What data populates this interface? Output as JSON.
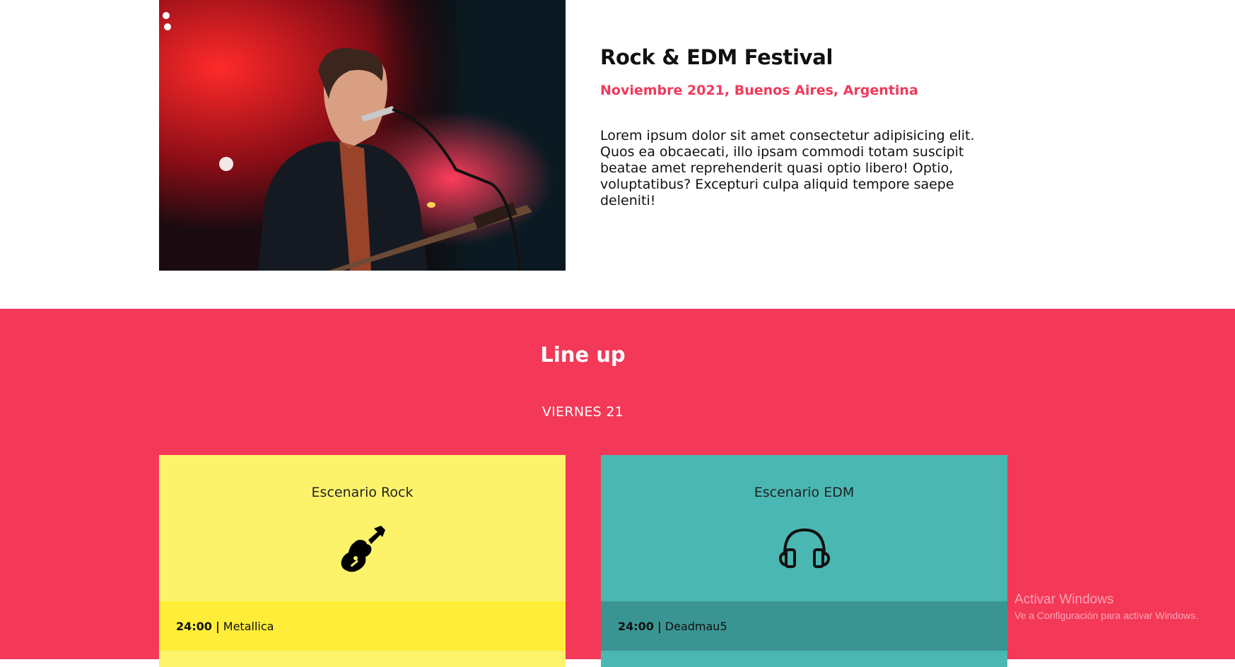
{
  "event": {
    "title": "Rock & EDM Festival",
    "date_location": "Noviembre 2021, Buenos Aires, Argentina",
    "description": "Lorem ipsum dolor sit amet consectetur adipisicing elit. Quos ea obcaecati, illo ipsam commodi totam suscipit beatae amet reprehenderit quasi optio libero! Optio, voluptatibus? Excepturi culpa aliquid tempore saepe deleniti!"
  },
  "lineup": {
    "title": "Line up",
    "day": "VIERNES 21",
    "stages": [
      {
        "name": "Escenario Rock",
        "icon": "guitar-icon",
        "time": "24:00",
        "separator": "|",
        "artist": "Metallica"
      },
      {
        "name": "Escenario EDM",
        "icon": "headphones-icon",
        "time": "24:00",
        "separator": "|",
        "artist": "Deadmau5"
      }
    ]
  },
  "watermark": {
    "title": "Activar Windows",
    "subtitle": "Ve a Configuración para activar Windows."
  },
  "colors": {
    "accent": "#f43857",
    "rock_stage": "#fdf36b",
    "edm_stage": "#4ab7b2"
  }
}
